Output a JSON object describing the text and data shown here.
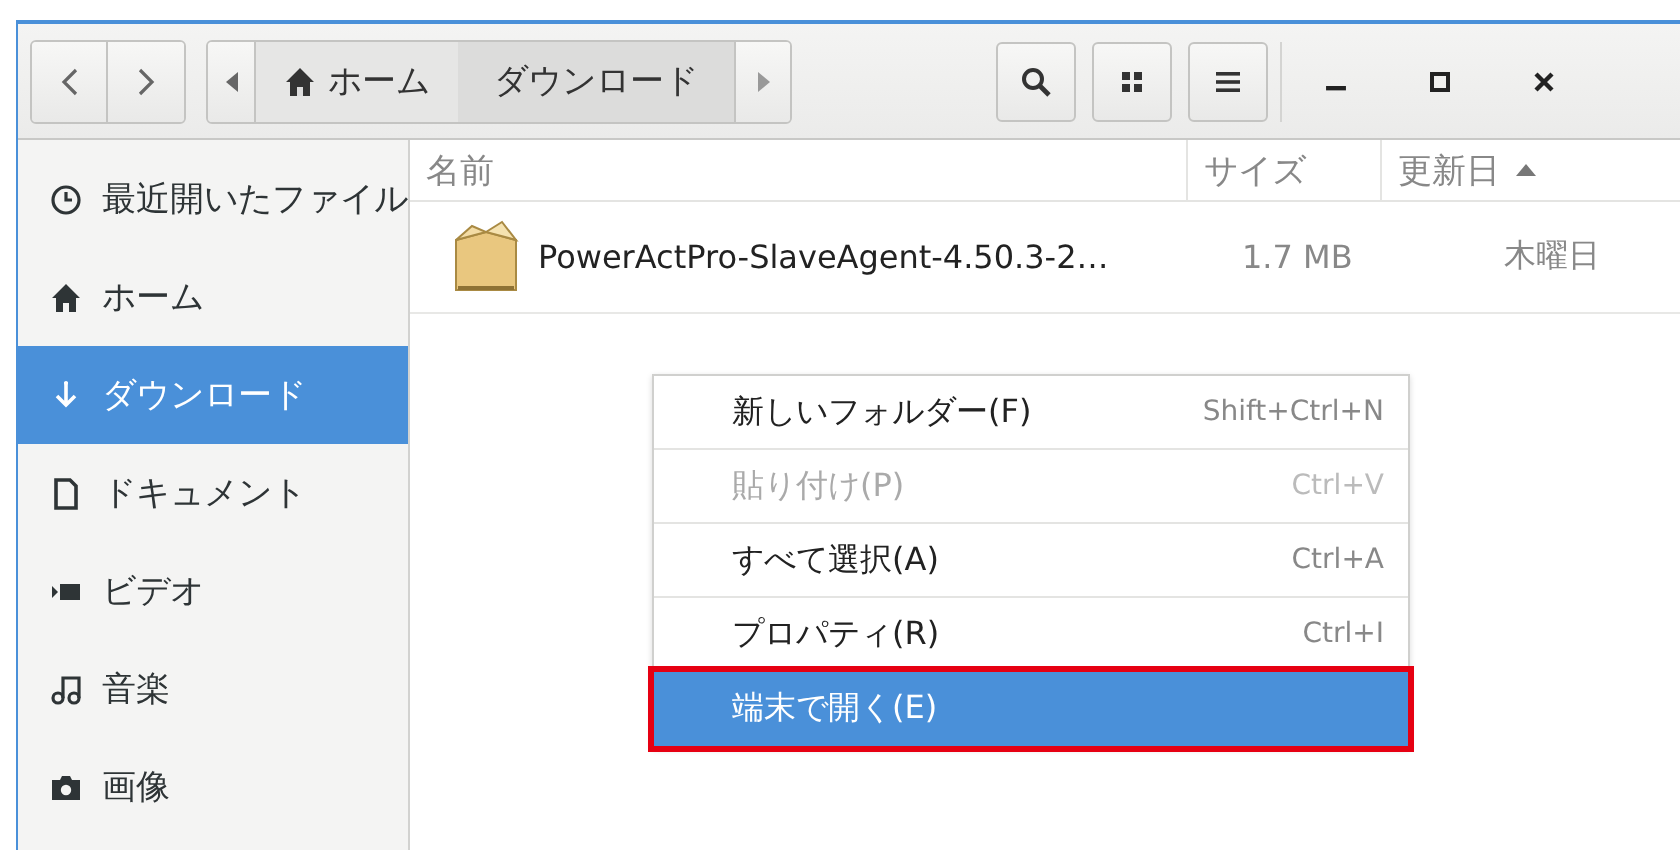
{
  "header": {
    "nav": [
      {
        "kind": "back"
      },
      {
        "kind": "forward"
      }
    ],
    "path": [
      {
        "kind": "home",
        "label": "ホーム",
        "selected": false
      },
      {
        "kind": "folder",
        "label": "ダウンロード",
        "selected": true
      }
    ],
    "tools": [
      {
        "kind": "search"
      },
      {
        "kind": "grid"
      },
      {
        "kind": "menu"
      }
    ],
    "window_controls": [
      {
        "kind": "minimize"
      },
      {
        "kind": "maximize"
      },
      {
        "kind": "close"
      }
    ]
  },
  "sidebar": {
    "items": [
      {
        "kind": "recent",
        "label": "最近開いたファイル",
        "selected": false
      },
      {
        "kind": "home",
        "label": "ホーム",
        "selected": false
      },
      {
        "kind": "download",
        "label": "ダウンロード",
        "selected": true
      },
      {
        "kind": "document",
        "label": "ドキュメント",
        "selected": false
      },
      {
        "kind": "video",
        "label": "ビデオ",
        "selected": false
      },
      {
        "kind": "music",
        "label": "音楽",
        "selected": false
      },
      {
        "kind": "picture",
        "label": "画像",
        "selected": false
      }
    ]
  },
  "table": {
    "columns": [
      {
        "label": "名前",
        "sorted": false
      },
      {
        "label": "サイズ",
        "sorted": false
      },
      {
        "label": "更新日",
        "sorted": true
      }
    ],
    "rows": [
      {
        "name": "PowerActPro-SlaveAgent-4.50.3-2…",
        "size": "1.7 MB",
        "modified": "木曜日"
      }
    ]
  },
  "context_menu": {
    "items": [
      {
        "label": "新しいフォルダー(F)",
        "shortcut": "Shift+Ctrl+N",
        "disabled": false,
        "selected": false,
        "outlined": false
      },
      {
        "label": "貼り付け(P)",
        "shortcut": "Ctrl+V",
        "disabled": true,
        "selected": false,
        "outlined": false
      },
      {
        "label": "すべて選択(A)",
        "shortcut": "Ctrl+A",
        "disabled": false,
        "selected": false,
        "outlined": false
      },
      {
        "label": "プロパティ(R)",
        "shortcut": "Ctrl+I",
        "disabled": false,
        "selected": false,
        "outlined": false
      },
      {
        "label": "端末で開く(E)",
        "disabled": false,
        "selected": true,
        "outlined": true
      }
    ]
  }
}
